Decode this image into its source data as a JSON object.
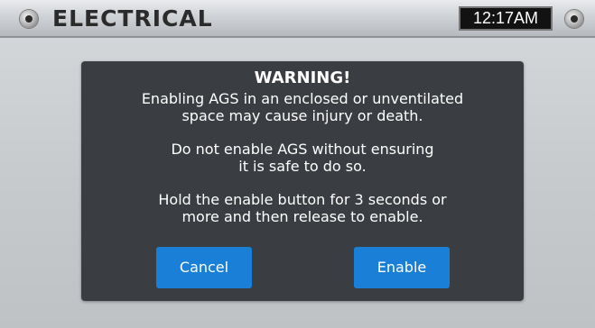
{
  "header": {
    "title": "ELECTRICAL",
    "time": "12:17AM"
  },
  "dialog": {
    "title": "WARNING!",
    "paragraphs": [
      [
        "Enabling AGS in an enclosed or unventilated",
        "space may cause injury or death."
      ],
      [
        "Do not enable AGS without ensuring",
        "it is safe to do so."
      ],
      [
        "Hold the enable button for 3 seconds or",
        "more and then release to enable."
      ]
    ],
    "buttons": {
      "cancel": "Cancel",
      "enable": "Enable"
    }
  },
  "colors": {
    "dialog_bg": "#3a3d41",
    "button_blue": "#1a7fd6",
    "text": "#ffffff"
  }
}
